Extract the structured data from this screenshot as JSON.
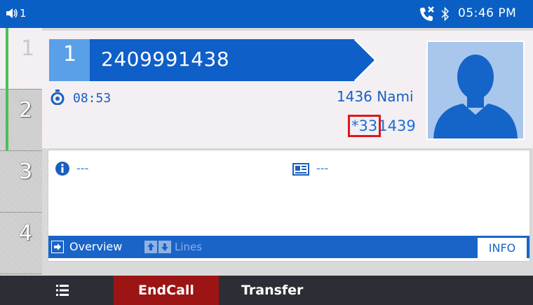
{
  "status_bar": {
    "volume_icon": "speaker-icon",
    "volume_level": "1",
    "call_icon": "missed-call-icon",
    "bluetooth_icon": "bluetooth-icon",
    "time": "05:46 PM"
  },
  "line_keys": [
    {
      "number": "1",
      "state": "active"
    },
    {
      "number": "2",
      "state": "idle"
    },
    {
      "number": "3",
      "state": "idle"
    },
    {
      "number": "4",
      "state": "idle"
    }
  ],
  "call": {
    "line_number": "1",
    "dialed_number": "2409991438",
    "duration": "08:53",
    "contact_name": "1436 Nami",
    "dial_code_highlight": "*33",
    "dial_code_rest": "1439",
    "avatar_icon": "person-silhouette-icon"
  },
  "info": {
    "info_value": "---",
    "card_value": "---",
    "info_icon": "info-icon",
    "card_icon": "contact-card-icon"
  },
  "nav": {
    "overview_label": "Overview",
    "lines_label": "Lines",
    "info_tab": "INFO"
  },
  "softkeys": {
    "menu_icon": "menu-icon",
    "end_call": "EndCall",
    "transfer": "Transfer"
  },
  "colors": {
    "accent": "#0a5fc4",
    "end_call": "#9c1414",
    "highlight_box": "#e0161d"
  }
}
